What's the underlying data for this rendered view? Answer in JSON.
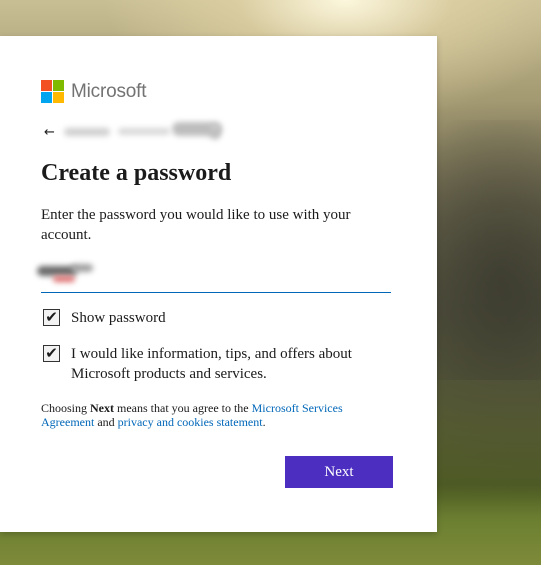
{
  "brand": {
    "name": "Microsoft",
    "logo_colors": [
      "#f25022",
      "#7fba00",
      "#00a4ef",
      "#ffb900"
    ]
  },
  "identity": {
    "back_icon": "arrow-left-icon",
    "email_visible_tail": "m"
  },
  "page": {
    "title": "Create a password",
    "description": "Enter the password you would like to use with your account."
  },
  "password_field": {
    "value_redacted": true
  },
  "options": {
    "show_password": {
      "label": "Show password",
      "checked": true
    },
    "marketing": {
      "label": "I would like information, tips, and offers about Microsoft products and services.",
      "checked": true
    }
  },
  "legal": {
    "prefix": "Choosing ",
    "next_word": "Next",
    "middle": " means that you agree to the ",
    "agreement_link": "Microsoft Services Agreement",
    "and": " and ",
    "privacy_link": "privacy and cookies statement",
    "suffix": "."
  },
  "buttons": {
    "next_label": "Next"
  },
  "colors": {
    "accent": "#4c2fc1",
    "link": "#0067b8"
  }
}
